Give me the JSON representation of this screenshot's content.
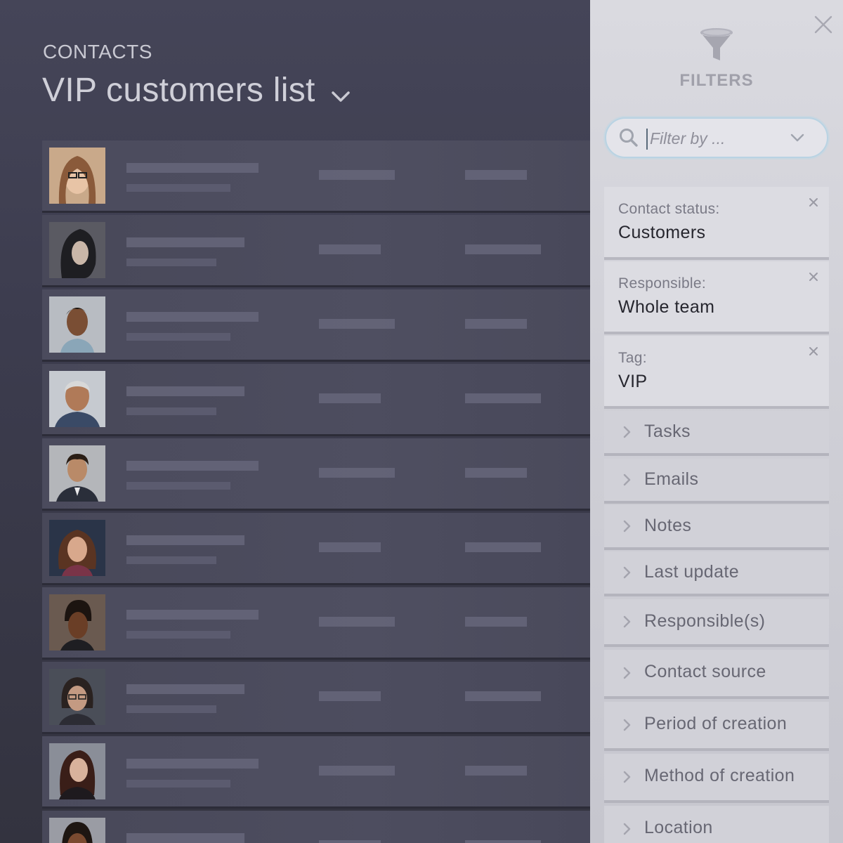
{
  "header": {
    "section_label": "CONTACTS",
    "list_title": "VIP customers list"
  },
  "filter_panel": {
    "heading": "FILTERS",
    "search": {
      "placeholder": "Filter by ..."
    },
    "active_filters": [
      {
        "label": "Contact status:",
        "value": "Customers"
      },
      {
        "label": "Responsible:",
        "value": "Whole team"
      },
      {
        "label": "Tag:",
        "value": "VIP"
      }
    ],
    "collapsed_filters": [
      {
        "label": "Tasks"
      },
      {
        "label": "Emails"
      },
      {
        "label": "Notes"
      },
      {
        "label": "Last update"
      },
      {
        "label": "Responsible(s)"
      },
      {
        "label": "Contact source"
      },
      {
        "label": "Period of creation"
      },
      {
        "label": "Method of creation"
      },
      {
        "label": "Location"
      }
    ]
  },
  "colors": {
    "contacts_bg": "#3c3c4e",
    "panel_bg": "#d3d3da",
    "search_border": "#b9d3e3"
  }
}
